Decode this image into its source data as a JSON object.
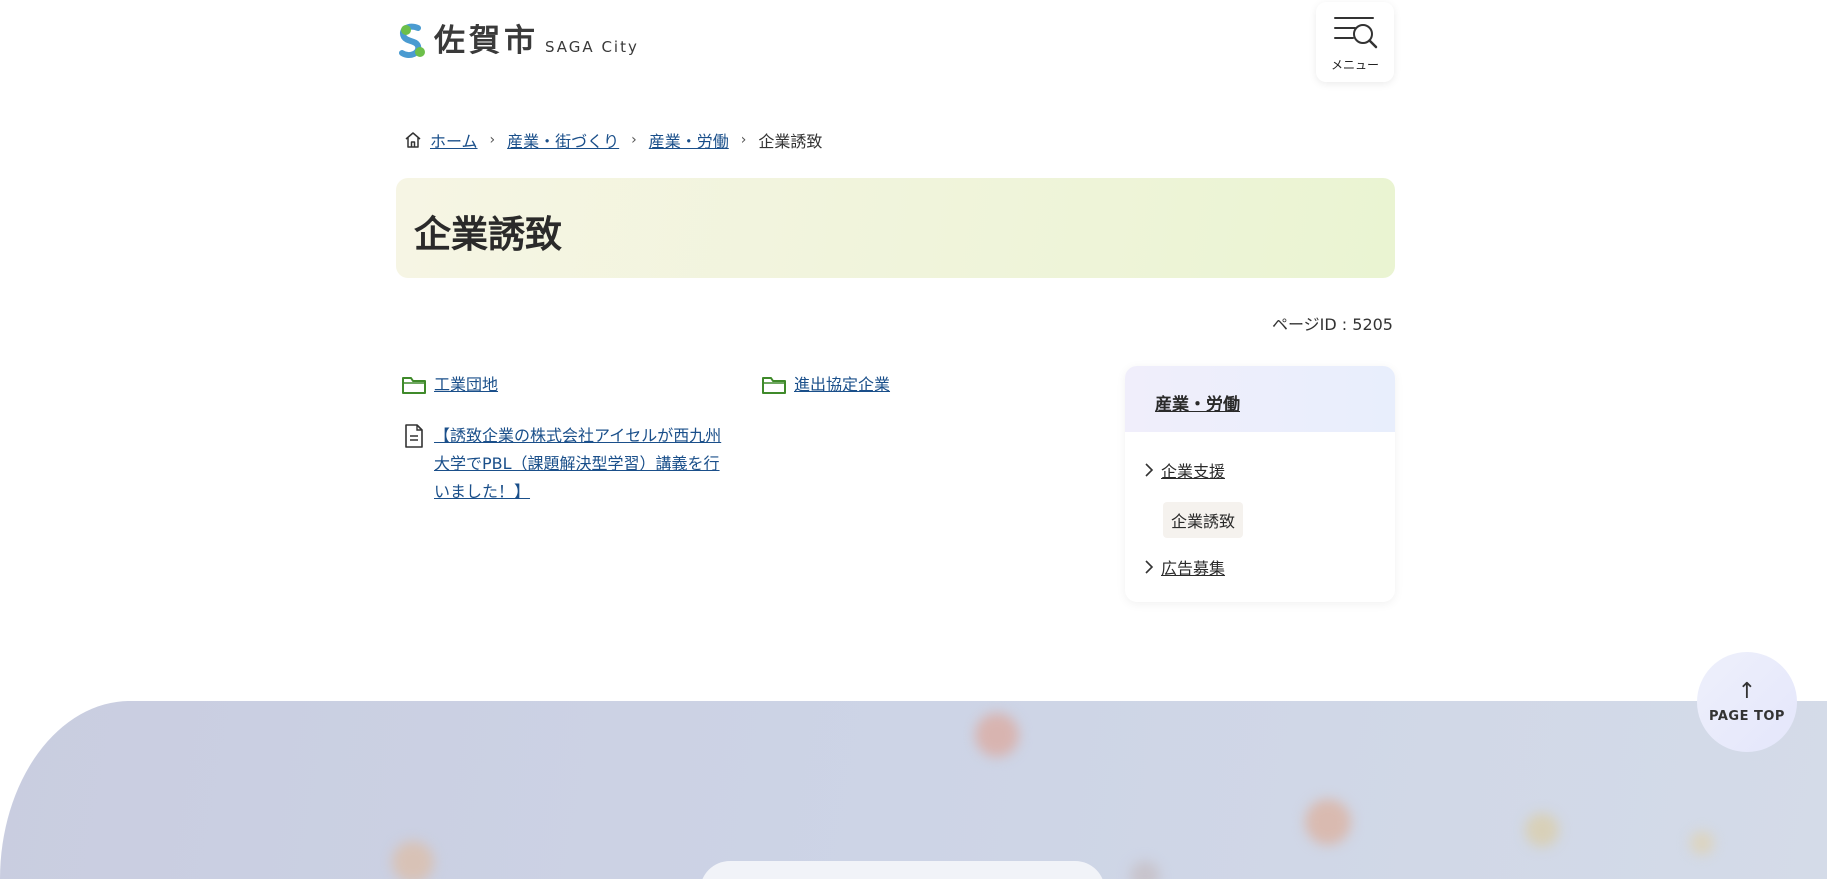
{
  "header": {
    "logo_main": "佐賀市",
    "logo_sub": "SAGA City",
    "menu_label": "メニュー"
  },
  "breadcrumb": {
    "items": [
      "ホーム",
      "産業・街づくり",
      "産業・労働"
    ],
    "current": "企業誘致"
  },
  "page": {
    "title": "企業誘致",
    "page_id": "ページID : 5205"
  },
  "content": {
    "folders": [
      "工業団地",
      "進出協定企業"
    ],
    "documents": [
      "【誘致企業の株式会社アイセルが西九州大学でPBL（課題解決型学習）講義を行いました！】"
    ]
  },
  "side_nav": {
    "heading": "産業・労働",
    "items": [
      "企業支援",
      "広告募集"
    ],
    "current": "企業誘致"
  },
  "page_top": {
    "arrow": "↑",
    "label": "PAGE TOP"
  },
  "colors": {
    "link": "#1a4f8a",
    "folder_icon": "#3f8a2a",
    "title_band": "#eef4d8",
    "footer": "#cdd4e6"
  }
}
